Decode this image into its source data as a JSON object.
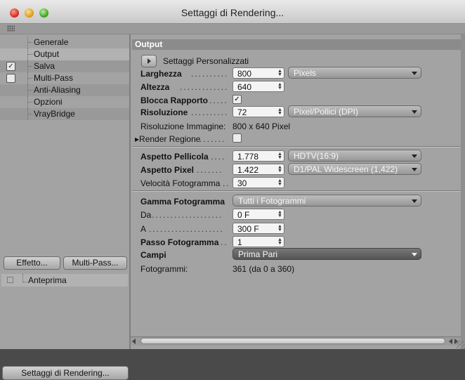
{
  "window": {
    "title": "Settaggi di Rendering..."
  },
  "sidebar": {
    "items": [
      {
        "label": "Generale",
        "checkbox": null
      },
      {
        "label": "Output",
        "checkbox": null,
        "selected": true
      },
      {
        "label": "Salva",
        "checkbox": "checked"
      },
      {
        "label": "Multi-Pass",
        "checkbox": "unchecked"
      },
      {
        "label": "Anti-Aliasing",
        "checkbox": null
      },
      {
        "label": "Opzioni",
        "checkbox": null
      },
      {
        "label": "VrayBridge",
        "checkbox": null
      }
    ],
    "effect_button": "Effetto...",
    "multipass_button": "Multi-Pass...",
    "preview_label": "Anteprima",
    "bottom_button": "Settaggi di Rendering..."
  },
  "output": {
    "section_title": "Output",
    "preset_label": "Settaggi  Personalizzati",
    "width": {
      "label": "Larghezza",
      "value": "800",
      "unit": "Pixels"
    },
    "height": {
      "label": "Altezza",
      "value": "640"
    },
    "lock_ratio": {
      "label": "Blocca Rapporto",
      "checked": true
    },
    "resolution": {
      "label": "Risoluzione",
      "value": "72",
      "unit": "Pixel/Pollici (DPI)"
    },
    "image_resolution": {
      "label": "Risoluzione Immagine:",
      "value": "800 x 640 Pixel"
    },
    "render_region": {
      "label": "Render Regione",
      "checked": false
    },
    "film_aspect": {
      "label": "Aspetto Pellicola",
      "value": "1.778",
      "preset": "HDTV(16:9)"
    },
    "pixel_aspect": {
      "label": "Aspetto Pixel",
      "value": "1.422",
      "preset": "D1/PAL Widescreen (1,422)"
    },
    "frame_rate": {
      "label": "Velocità Fotogramma",
      "value": "30"
    },
    "frame_range": {
      "label": "Gamma Fotogramma",
      "value": "Tutti i Fotogrammi"
    },
    "from": {
      "label": "Da",
      "value": "0 F"
    },
    "to": {
      "label": "A",
      "value": "300 F"
    },
    "frame_step": {
      "label": "Passo Fotogramma",
      "value": "1"
    },
    "fields": {
      "label": "Campi",
      "value": "Prima Pari"
    },
    "frames": {
      "label": "Fotogrammi:",
      "value": "361 (da 0 a 360)"
    }
  },
  "icons": {
    "check": "✓",
    "play": "play-icon",
    "spinner": "stepper-arrows-icon",
    "dropdown": "chevron-down-icon"
  }
}
